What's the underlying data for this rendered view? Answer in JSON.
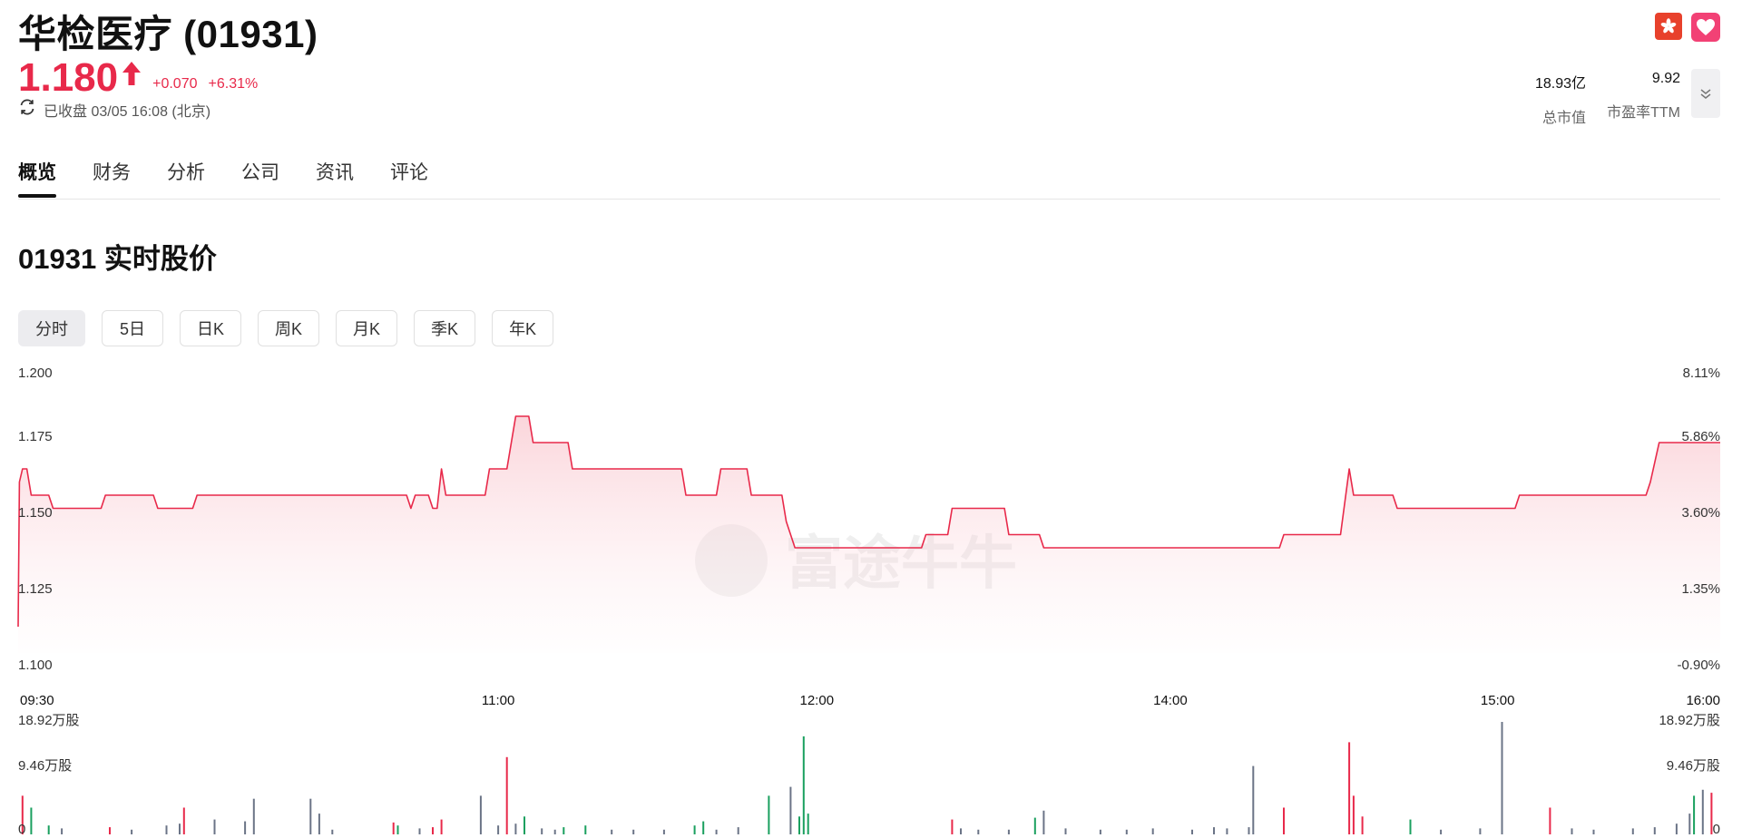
{
  "header": {
    "title": "华检医疗 (01931)",
    "price": "1.180",
    "change_abs": "+0.070",
    "change_pct": "+6.31%",
    "status": "已收盘 03/05 16:08 (北京)",
    "market_cap_value": "18.93亿",
    "market_cap_label": "总市值",
    "pe_value": "9.92",
    "pe_label": "市盈率TTM"
  },
  "colors": {
    "up": "#e8294a",
    "down": "#1aa05f",
    "neutral": "#6b7487"
  },
  "tabs": [
    {
      "label": "概览",
      "active": true
    },
    {
      "label": "财务",
      "active": false
    },
    {
      "label": "分析",
      "active": false
    },
    {
      "label": "公司",
      "active": false
    },
    {
      "label": "资讯",
      "active": false
    },
    {
      "label": "评论",
      "active": false
    }
  ],
  "section_title": "01931 实时股价",
  "periods": [
    {
      "label": "分时",
      "active": true
    },
    {
      "label": "5日",
      "active": false
    },
    {
      "label": "日K",
      "active": false
    },
    {
      "label": "周K",
      "active": false
    },
    {
      "label": "月K",
      "active": false
    },
    {
      "label": "季K",
      "active": false
    },
    {
      "label": "年K",
      "active": false
    }
  ],
  "watermark": "富途牛牛",
  "chart_data": {
    "type": "line",
    "ylim": [
      1.1,
      1.2
    ],
    "y_ticks_left": [
      "1.200",
      "1.175",
      "1.150",
      "1.125",
      "1.100"
    ],
    "y_ticks_right": [
      "8.11%",
      "5.86%",
      "3.60%",
      "1.35%",
      "-0.90%"
    ],
    "x_ticks": [
      "09:30",
      "11:00",
      "12:00",
      "14:00",
      "15:00",
      "16:00"
    ],
    "x_minutes": [
      0,
      390
    ],
    "price_series": [
      [
        0,
        1.11
      ],
      [
        0.3,
        1.165
      ],
      [
        1,
        1.17
      ],
      [
        2,
        1.17
      ],
      [
        3,
        1.16
      ],
      [
        7,
        1.16
      ],
      [
        8,
        1.155
      ],
      [
        19,
        1.155
      ],
      [
        20,
        1.16
      ],
      [
        31,
        1.16
      ],
      [
        32,
        1.155
      ],
      [
        40,
        1.155
      ],
      [
        41,
        1.16
      ],
      [
        89,
        1.16
      ],
      [
        90,
        1.155
      ],
      [
        91,
        1.16
      ],
      [
        94,
        1.16
      ],
      [
        95,
        1.155
      ],
      [
        96,
        1.155
      ],
      [
        97,
        1.17
      ],
      [
        98,
        1.16
      ],
      [
        107,
        1.16
      ],
      [
        108,
        1.17
      ],
      [
        112,
        1.17
      ],
      [
        114,
        1.19
      ],
      [
        117,
        1.19
      ],
      [
        118,
        1.18
      ],
      [
        126,
        1.18
      ],
      [
        127,
        1.17
      ],
      [
        152,
        1.17
      ],
      [
        153,
        1.16
      ],
      [
        160,
        1.16
      ],
      [
        161,
        1.17
      ],
      [
        167,
        1.17
      ],
      [
        168,
        1.16
      ],
      [
        175,
        1.16
      ],
      [
        176,
        1.15
      ],
      [
        178,
        1.14
      ],
      [
        207,
        1.14
      ],
      [
        208,
        1.145
      ],
      [
        213,
        1.145
      ],
      [
        214,
        1.155
      ],
      [
        226,
        1.155
      ],
      [
        227,
        1.145
      ],
      [
        234,
        1.145
      ],
      [
        235,
        1.14
      ],
      [
        289,
        1.14
      ],
      [
        290,
        1.145
      ],
      [
        303,
        1.145
      ],
      [
        305,
        1.17
      ],
      [
        306,
        1.16
      ],
      [
        315,
        1.16
      ],
      [
        316,
        1.155
      ],
      [
        343,
        1.155
      ],
      [
        344,
        1.16
      ],
      [
        373,
        1.16
      ],
      [
        374,
        1.165
      ],
      [
        376,
        1.18
      ],
      [
        390,
        1.18
      ]
    ],
    "volume_labels": {
      "max": "18.92万股",
      "mid": "9.46万股",
      "zero": "0"
    },
    "volume_max": 18.92,
    "volume_bars": [
      {
        "t": 1,
        "v": 6.5,
        "c": "up"
      },
      {
        "t": 3,
        "v": 4.5,
        "c": "down"
      },
      {
        "t": 7,
        "v": 1.5,
        "c": "down"
      },
      {
        "t": 10,
        "v": 1.0,
        "c": "neutral"
      },
      {
        "t": 21,
        "v": 1.2,
        "c": "up"
      },
      {
        "t": 26,
        "v": 0.8,
        "c": "neutral"
      },
      {
        "t": 34,
        "v": 1.5,
        "c": "neutral"
      },
      {
        "t": 37,
        "v": 1.8,
        "c": "neutral"
      },
      {
        "t": 38,
        "v": 4.5,
        "c": "up"
      },
      {
        "t": 45,
        "v": 2.5,
        "c": "neutral"
      },
      {
        "t": 52,
        "v": 2.2,
        "c": "neutral"
      },
      {
        "t": 54,
        "v": 6.0,
        "c": "neutral"
      },
      {
        "t": 67,
        "v": 6.0,
        "c": "neutral"
      },
      {
        "t": 69,
        "v": 3.5,
        "c": "neutral"
      },
      {
        "t": 72,
        "v": 0.8,
        "c": "neutral"
      },
      {
        "t": 86,
        "v": 2.0,
        "c": "up"
      },
      {
        "t": 87,
        "v": 1.5,
        "c": "down"
      },
      {
        "t": 92,
        "v": 1.0,
        "c": "neutral"
      },
      {
        "t": 95,
        "v": 1.2,
        "c": "up"
      },
      {
        "t": 97,
        "v": 2.5,
        "c": "up"
      },
      {
        "t": 106,
        "v": 6.5,
        "c": "neutral"
      },
      {
        "t": 110,
        "v": 1.5,
        "c": "neutral"
      },
      {
        "t": 112,
        "v": 13.0,
        "c": "up"
      },
      {
        "t": 114,
        "v": 1.8,
        "c": "neutral"
      },
      {
        "t": 116,
        "v": 3.0,
        "c": "down"
      },
      {
        "t": 120,
        "v": 1.0,
        "c": "neutral"
      },
      {
        "t": 123,
        "v": 0.8,
        "c": "neutral"
      },
      {
        "t": 125,
        "v": 1.2,
        "c": "down"
      },
      {
        "t": 130,
        "v": 1.5,
        "c": "down"
      },
      {
        "t": 136,
        "v": 0.8,
        "c": "neutral"
      },
      {
        "t": 141,
        "v": 0.8,
        "c": "neutral"
      },
      {
        "t": 148,
        "v": 0.8,
        "c": "neutral"
      },
      {
        "t": 155,
        "v": 1.5,
        "c": "down"
      },
      {
        "t": 157,
        "v": 2.2,
        "c": "down"
      },
      {
        "t": 160,
        "v": 0.8,
        "c": "neutral"
      },
      {
        "t": 165,
        "v": 1.2,
        "c": "neutral"
      },
      {
        "t": 172,
        "v": 6.5,
        "c": "down"
      },
      {
        "t": 177,
        "v": 8.0,
        "c": "neutral"
      },
      {
        "t": 179,
        "v": 3.0,
        "c": "down"
      },
      {
        "t": 180,
        "v": 16.5,
        "c": "down"
      },
      {
        "t": 181,
        "v": 3.5,
        "c": "down"
      },
      {
        "t": 214,
        "v": 2.5,
        "c": "up"
      },
      {
        "t": 216,
        "v": 1.0,
        "c": "neutral"
      },
      {
        "t": 220,
        "v": 0.8,
        "c": "neutral"
      },
      {
        "t": 227,
        "v": 0.8,
        "c": "neutral"
      },
      {
        "t": 233,
        "v": 2.8,
        "c": "down"
      },
      {
        "t": 235,
        "v": 4.0,
        "c": "neutral"
      },
      {
        "t": 240,
        "v": 1.0,
        "c": "neutral"
      },
      {
        "t": 248,
        "v": 0.8,
        "c": "neutral"
      },
      {
        "t": 254,
        "v": 0.8,
        "c": "neutral"
      },
      {
        "t": 260,
        "v": 1.0,
        "c": "neutral"
      },
      {
        "t": 269,
        "v": 0.8,
        "c": "neutral"
      },
      {
        "t": 274,
        "v": 1.2,
        "c": "neutral"
      },
      {
        "t": 277,
        "v": 1.0,
        "c": "neutral"
      },
      {
        "t": 282,
        "v": 1.2,
        "c": "neutral"
      },
      {
        "t": 283,
        "v": 11.5,
        "c": "neutral"
      },
      {
        "t": 290,
        "v": 4.5,
        "c": "up"
      },
      {
        "t": 305,
        "v": 15.5,
        "c": "up"
      },
      {
        "t": 306,
        "v": 6.5,
        "c": "up"
      },
      {
        "t": 308,
        "v": 3.0,
        "c": "up"
      },
      {
        "t": 319,
        "v": 2.5,
        "c": "down"
      },
      {
        "t": 326,
        "v": 0.8,
        "c": "neutral"
      },
      {
        "t": 335,
        "v": 1.0,
        "c": "neutral"
      },
      {
        "t": 340,
        "v": 18.92,
        "c": "neutral"
      },
      {
        "t": 351,
        "v": 4.5,
        "c": "up"
      },
      {
        "t": 356,
        "v": 1.0,
        "c": "neutral"
      },
      {
        "t": 361,
        "v": 0.8,
        "c": "neutral"
      },
      {
        "t": 370,
        "v": 1.0,
        "c": "neutral"
      },
      {
        "t": 375,
        "v": 1.2,
        "c": "neutral"
      },
      {
        "t": 380,
        "v": 1.8,
        "c": "neutral"
      },
      {
        "t": 383,
        "v": 3.5,
        "c": "neutral"
      },
      {
        "t": 384,
        "v": 6.5,
        "c": "down"
      },
      {
        "t": 386,
        "v": 7.5,
        "c": "neutral"
      },
      {
        "t": 388,
        "v": 7.0,
        "c": "up"
      }
    ]
  }
}
